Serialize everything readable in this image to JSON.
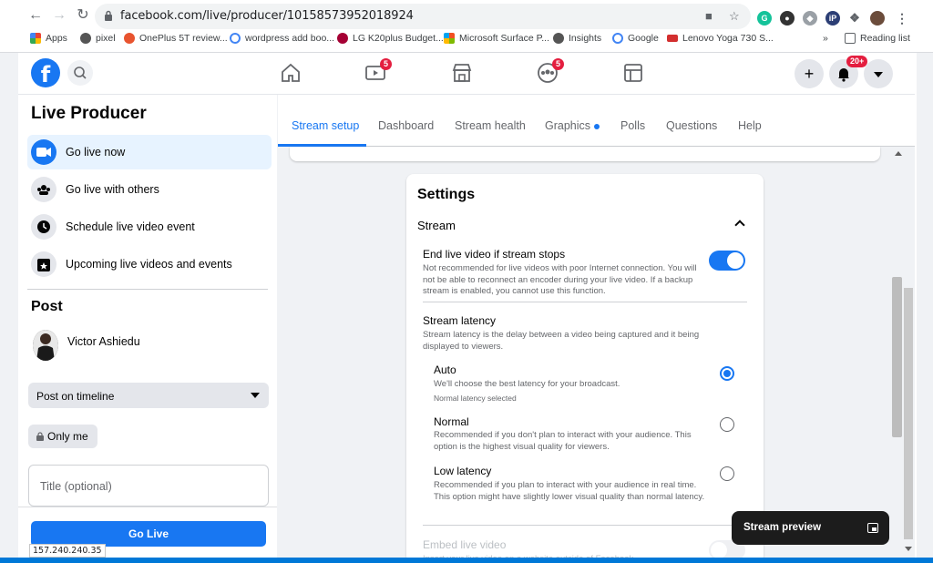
{
  "browser": {
    "url": "facebook.com/live/producer/10158573952018924",
    "bookmarks": [
      {
        "label": "Apps",
        "icon": "apps-grid-icon"
      },
      {
        "label": "pixel",
        "icon": "apple-icon"
      },
      {
        "label": "OnePlus 5T review...",
        "icon": "oneplus-icon"
      },
      {
        "label": "wordpress add boo...",
        "icon": "google-icon"
      },
      {
        "label": "LG K20plus Budget...",
        "icon": "lg-icon"
      },
      {
        "label": "Microsoft Surface P...",
        "icon": "microsoft-icon"
      },
      {
        "label": "Insights",
        "icon": "globe-icon"
      },
      {
        "label": "Google",
        "icon": "google-icon"
      },
      {
        "label": "Lenovo Yoga 730 S...",
        "icon": "djibit-icon"
      }
    ],
    "more_bookmarks": "»",
    "reading_list": "Reading list",
    "status_text": "157.240.240.35"
  },
  "fbnav": {
    "watch_badge": "5",
    "groups_badge": "5",
    "notifications_badge": "20+"
  },
  "sidebar": {
    "title": "Live Producer",
    "items": [
      {
        "label": "Go live now"
      },
      {
        "label": "Go live with others"
      },
      {
        "label": "Schedule live video event"
      },
      {
        "label": "Upcoming live videos and events"
      }
    ],
    "post_title": "Post",
    "user_name": "Victor Ashiedu",
    "post_target": "Post on timeline",
    "privacy": "Only me",
    "title_placeholder": "Title (optional)",
    "go_live_label": "Go Live"
  },
  "tabs": [
    {
      "label": "Stream setup"
    },
    {
      "label": "Dashboard"
    },
    {
      "label": "Stream health"
    },
    {
      "label": "Graphics"
    },
    {
      "label": "Polls"
    },
    {
      "label": "Questions"
    },
    {
      "label": "Help"
    }
  ],
  "settings": {
    "heading": "Settings",
    "section": "Stream",
    "end_live": {
      "label": "End live video if stream stops",
      "help": "Not recommended for live videos with poor Internet connection. You will not be able to reconnect an encoder during your live video. If a backup stream is enabled, you cannot use this function.",
      "enabled": true
    },
    "latency": {
      "label": "Stream latency",
      "help": "Stream latency is the delay between a video being captured and it being displayed to viewers.",
      "options": [
        {
          "label": "Auto",
          "help": "We'll choose the best latency for your broadcast.",
          "note": "Normal latency selected",
          "selected": true
        },
        {
          "label": "Normal",
          "help": "Recommended if you don't plan to interact with your audience. This option is the highest visual quality for viewers.",
          "selected": false
        },
        {
          "label": "Low latency",
          "help": "Recommended if you plan to interact with your audience in real time. This option might have slightly lower visual quality than normal latency.",
          "selected": false
        }
      ]
    },
    "embed": {
      "label": "Embed live video",
      "help": "Insert your live video on a website outside of Facebook."
    }
  },
  "stream_preview": {
    "label": "Stream preview"
  },
  "colors": {
    "fb_blue": "#1877f2",
    "badge_red": "#e41e3f",
    "background": "#f0f2f5"
  }
}
